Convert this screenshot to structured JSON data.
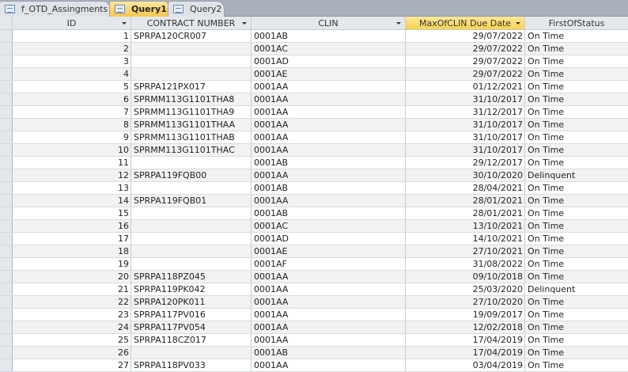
{
  "tabs": [
    {
      "label": "f_OTD_Assingments",
      "icon": "form-icon"
    },
    {
      "label": "Query1",
      "icon": "query-icon",
      "active": true
    },
    {
      "label": "Query2",
      "icon": "query-icon"
    }
  ],
  "columns": [
    "ID",
    "CONTRACT NUMBER",
    "CLIN",
    "MaxOfCLIN Due Date",
    "FirstOfStatus"
  ],
  "rows": [
    [
      "1",
      "SPRPA120CR007",
      "0001AB",
      "29/07/2022",
      "On Time"
    ],
    [
      "2",
      "",
      "0001AC",
      "29/07/2022",
      "On Time"
    ],
    [
      "3",
      "",
      "0001AD",
      "29/07/2022",
      "On Time"
    ],
    [
      "4",
      "",
      "0001AE",
      "29/07/2022",
      "On Time"
    ],
    [
      "5",
      "SPRPA121PX017",
      "0001AA",
      "01/12/2021",
      "On Time"
    ],
    [
      "6",
      "SPRMM113G1101THA8",
      "0001AA",
      "31/10/2017",
      "On Time"
    ],
    [
      "7",
      "SPRMM113G1101THA9",
      "0001AA",
      "31/12/2017",
      "On Time"
    ],
    [
      "8",
      "SPRMM113G1101THAA",
      "0001AA",
      "31/10/2017",
      "On Time"
    ],
    [
      "9",
      "SPRMM113G1101THAB",
      "0001AA",
      "31/10/2017",
      "On Time"
    ],
    [
      "10",
      "SPRMM113G1101THAC",
      "0001AA",
      "31/10/2017",
      "On Time"
    ],
    [
      "11",
      "",
      "0001AB",
      "29/12/2017",
      "On Time"
    ],
    [
      "12",
      "SPRPA119FQB00",
      "0001AA",
      "30/10/2020",
      "Delinquent"
    ],
    [
      "13",
      "",
      "0001AB",
      "28/04/2021",
      "On Time"
    ],
    [
      "14",
      "SPRPA119FQB01",
      "0001AA",
      "28/01/2021",
      "On Time"
    ],
    [
      "15",
      "",
      "0001AB",
      "28/01/2021",
      "On Time"
    ],
    [
      "16",
      "",
      "0001AC",
      "13/10/2021",
      "On Time"
    ],
    [
      "17",
      "",
      "0001AD",
      "14/10/2021",
      "On Time"
    ],
    [
      "18",
      "",
      "0001AE",
      "27/10/2021",
      "On Time"
    ],
    [
      "19",
      "",
      "0001AF",
      "31/08/2022",
      "On Time"
    ],
    [
      "20",
      "SPRPA118PZ045",
      "0001AA",
      "09/10/2018",
      "On Time"
    ],
    [
      "21",
      "SPRPA119PK042",
      "0001AA",
      "25/03/2020",
      "Delinquent"
    ],
    [
      "22",
      "SPRPA120PK011",
      "0001AA",
      "27/10/2020",
      "On Time"
    ],
    [
      "23",
      "SPRPA117PV016",
      "0001AA",
      "19/09/2017",
      "On Time"
    ],
    [
      "24",
      "SPRPA117PV054",
      "0001AA",
      "12/02/2018",
      "On Time"
    ],
    [
      "25",
      "SPRPA118CZ017",
      "0001AA",
      "17/04/2019",
      "On Time"
    ],
    [
      "26",
      "",
      "0001AB",
      "17/04/2019",
      "On Time"
    ],
    [
      "27",
      "SPRPA118PV033",
      "0001AA",
      "03/04/2019",
      "On Time"
    ]
  ]
}
